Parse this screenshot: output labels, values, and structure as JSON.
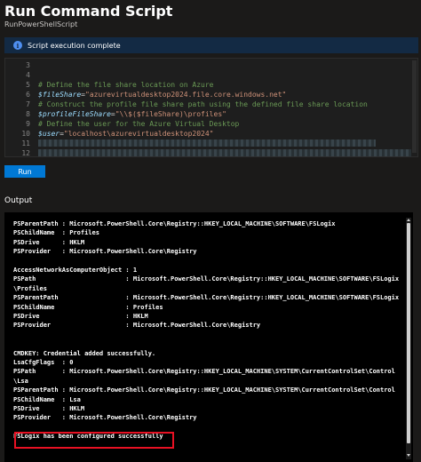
{
  "header": {
    "title": "Run Command Script",
    "subtitle": "RunPowerShellScript"
  },
  "banner": {
    "icon": "info-icon",
    "text": "Script execution complete"
  },
  "editor": {
    "lines": [
      {
        "num": "3",
        "type": "empty"
      },
      {
        "num": "4",
        "type": "empty"
      },
      {
        "num": "5",
        "type": "comment",
        "text": "# Define the file share location on Azure"
      },
      {
        "num": "6",
        "type": "assign",
        "var": "$fileShare",
        "op": "=",
        "value": "\"azurevirtualdesktop2024.file.core.windows.net\""
      },
      {
        "num": "7",
        "type": "comment",
        "text": "# Construct the profile file share path using the defined file share location"
      },
      {
        "num": "8",
        "type": "assign",
        "var": "$profileFileShare",
        "op": "=",
        "value": "\"\\\\$($fileShare)\\profiles\""
      },
      {
        "num": "9",
        "type": "comment",
        "text": "# Define the user for the Azure Virtual Desktop"
      },
      {
        "num": "10",
        "type": "assign",
        "var": "$user",
        "op": "=",
        "value": "\"localhost\\azurevirtualdesktop2024\""
      },
      {
        "num": "11",
        "type": "blurred",
        "blur_width": 380
      },
      {
        "num": "12",
        "type": "blurred",
        "blur_width": 420
      }
    ]
  },
  "run_button": {
    "label": "Run"
  },
  "output": {
    "label": "Output",
    "lines": [
      "PSParentPath : Microsoft.PowerShell.Core\\Registry::HKEY_LOCAL_MACHINE\\SOFTWARE\\FSLogix",
      "PSChildName  : Profiles",
      "PSDrive      : HKLM",
      "PSProvider   : Microsoft.PowerShell.Core\\Registry",
      "",
      "AccessNetworkAsComputerObject : 1",
      "PSPath                        : Microsoft.PowerShell.Core\\Registry::HKEY_LOCAL_MACHINE\\SOFTWARE\\FSLogix",
      "\\Profiles",
      "PSParentPath                  : Microsoft.PowerShell.Core\\Registry::HKEY_LOCAL_MACHINE\\SOFTWARE\\FSLogix",
      "PSChildName                   : Profiles",
      "PSDrive                       : HKLM",
      "PSProvider                    : Microsoft.PowerShell.Core\\Registry",
      "",
      "",
      "CMDKEY: Credential added successfully.",
      "LsaCfgFlags  : 0",
      "PSPath       : Microsoft.PowerShell.Core\\Registry::HKEY_LOCAL_MACHINE\\SYSTEM\\CurrentControlSet\\Control",
      "\\Lsa",
      "PSParentPath : Microsoft.PowerShell.Core\\Registry::HKEY_LOCAL_MACHINE\\SYSTEM\\CurrentControlSet\\Control",
      "PSChildName  : Lsa",
      "PSDrive      : HKLM",
      "PSProvider   : Microsoft.PowerShell.Core\\Registry",
      "",
      "FSLogix has been configured successfully"
    ]
  },
  "colors": {
    "background": "#1b1a19",
    "banner_bg": "#132a44",
    "accent": "#0078d4",
    "highlight": "#e81123",
    "comment": "#6a9955",
    "variable": "#9cdcfe",
    "string": "#ce9178"
  }
}
